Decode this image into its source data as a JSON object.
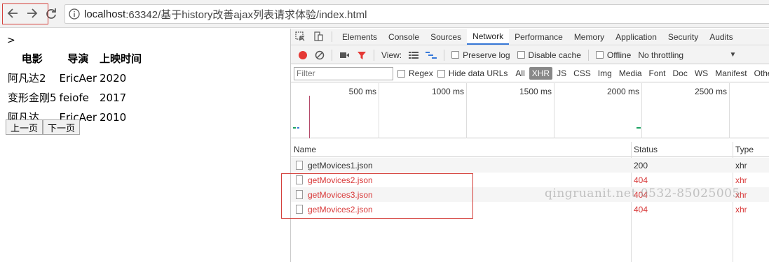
{
  "browser": {
    "url_host": "localhost",
    "url_path": ":63342/基于history改善ajax列表请求体验/index.html"
  },
  "page": {
    "marker": ">",
    "table": {
      "headers": [
        "电影",
        "导演",
        "上映时间"
      ],
      "rows": [
        [
          "阿凡达2",
          "EricAer",
          "2020"
        ],
        [
          "变形金刚5",
          "feiofe",
          "2017"
        ],
        [
          "阿凡达",
          "EricAer",
          "2010"
        ]
      ]
    },
    "pager": {
      "prev": "上一页",
      "next": "下一页"
    }
  },
  "devtools": {
    "tabs": [
      "Elements",
      "Console",
      "Sources",
      "Network",
      "Performance",
      "Memory",
      "Application",
      "Security",
      "Audits"
    ],
    "active_tab": "Network",
    "toolbar": {
      "view_label": "View:",
      "preserve_log": "Preserve log",
      "disable_cache": "Disable cache",
      "offline": "Offline",
      "throttling": "No throttling"
    },
    "filter": {
      "placeholder": "Filter",
      "regex": "Regex",
      "hide_data_urls": "Hide data URLs",
      "types": [
        "All",
        "XHR",
        "JS",
        "CSS",
        "Img",
        "Media",
        "Font",
        "Doc",
        "WS",
        "Manifest",
        "Other"
      ],
      "active_type": "XHR"
    },
    "timeline": {
      "ticks": [
        "500 ms",
        "1000 ms",
        "1500 ms",
        "2000 ms",
        "2500 ms"
      ]
    },
    "grid": {
      "columns": [
        "Name",
        "Status",
        "Type"
      ],
      "rows": [
        {
          "name": "getMovices1.json",
          "status": "200",
          "type": "xhr",
          "error": false
        },
        {
          "name": "getMovices2.json",
          "status": "404",
          "type": "xhr",
          "error": true
        },
        {
          "name": "getMovices3.json",
          "status": "404",
          "type": "xhr",
          "error": true
        },
        {
          "name": "getMovices2.json",
          "status": "404",
          "type": "xhr",
          "error": true
        }
      ]
    },
    "colors": {
      "accent": "#3879d9",
      "error": "#d93a3a",
      "record": "#e53935",
      "highlight": "#d43f3a"
    }
  },
  "watermark": "qingruanit.net 0532-85025005"
}
